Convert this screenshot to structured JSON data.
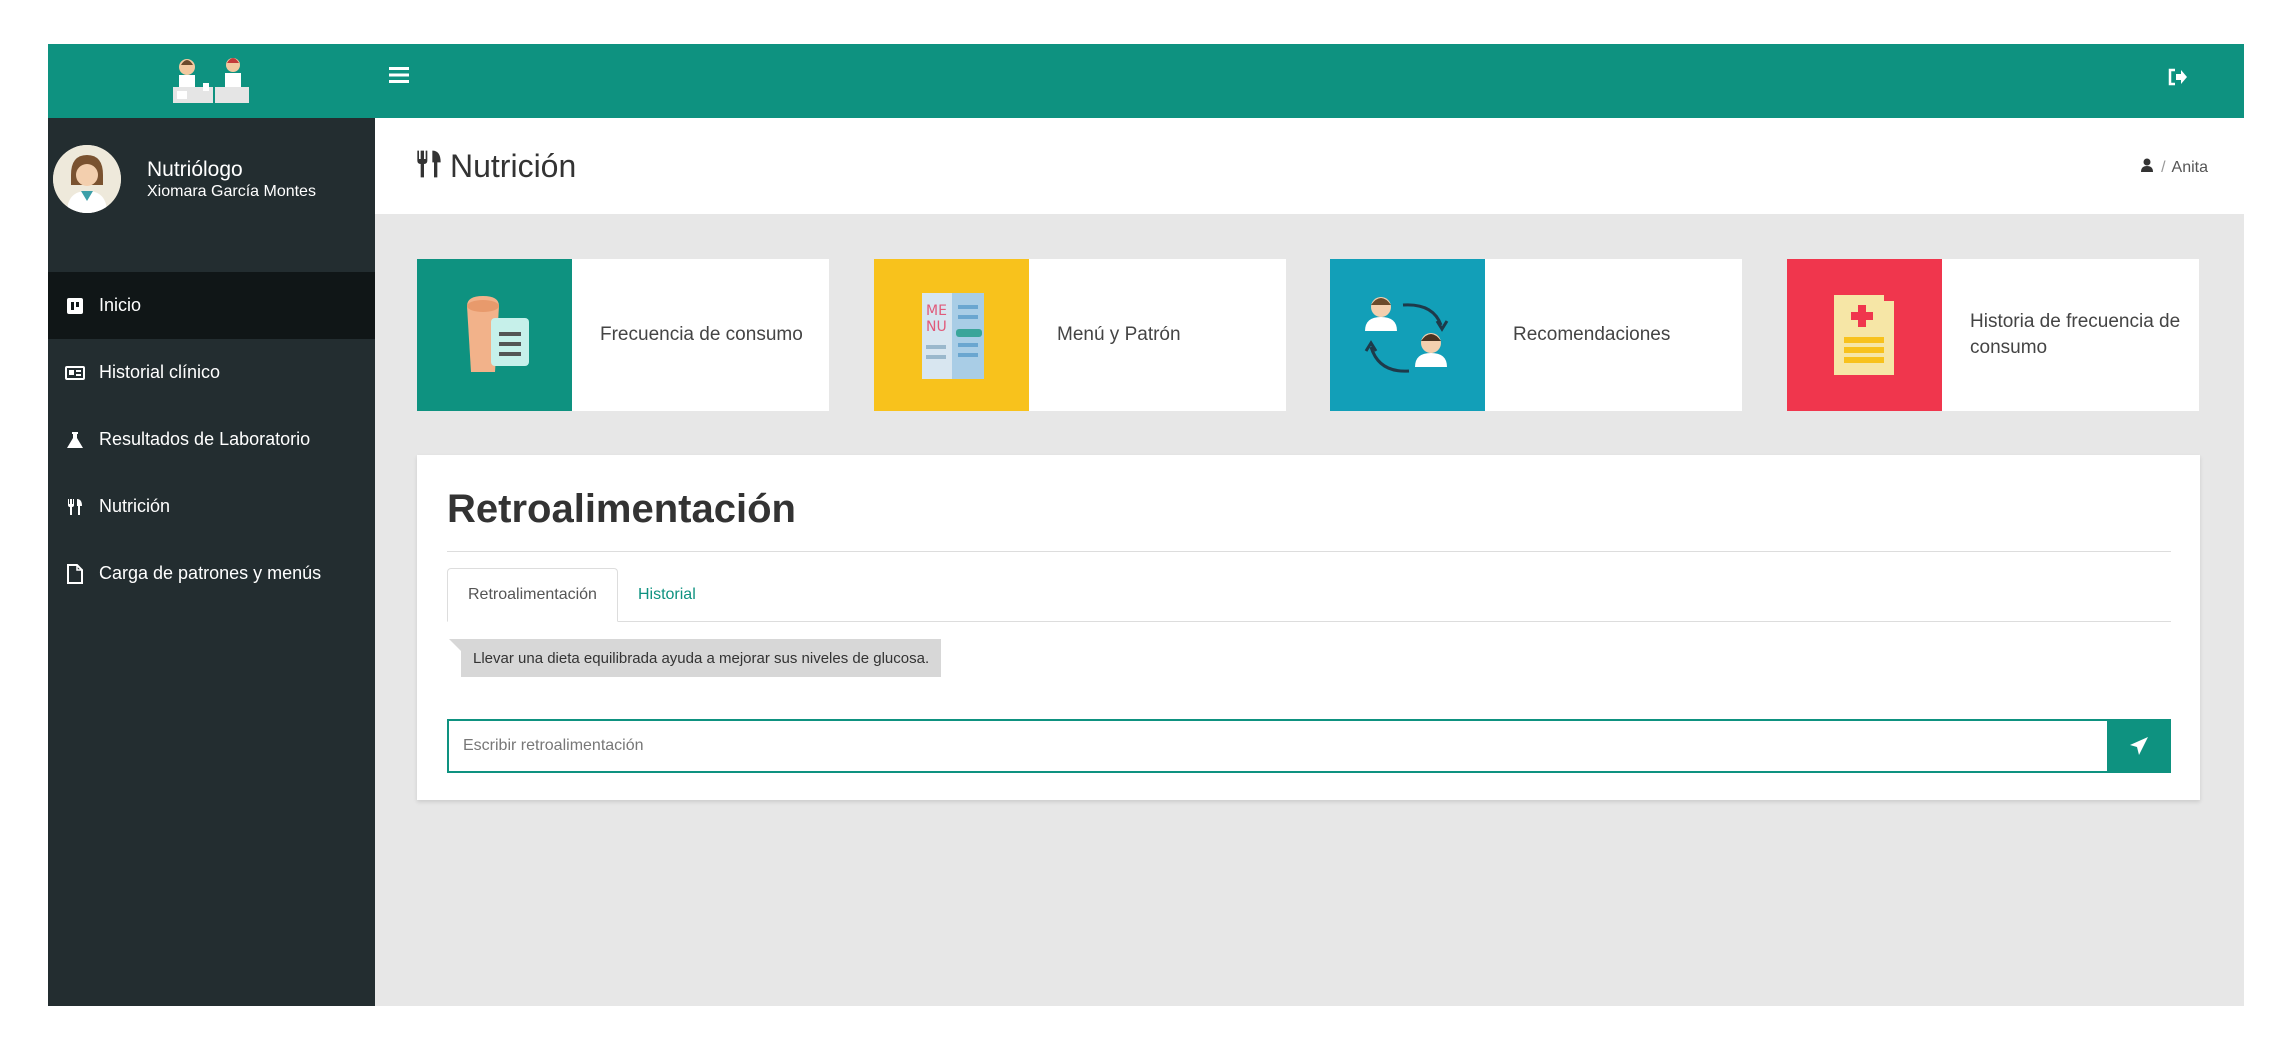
{
  "user": {
    "role": "Nutriólogo",
    "name": "Xiomara García Montes"
  },
  "sidebar": {
    "items": [
      {
        "label": "Inicio",
        "icon": "dashboard-icon"
      },
      {
        "label": "Historial clínico",
        "icon": "id-card-icon"
      },
      {
        "label": "Resultados de Laboratorio",
        "icon": "flask-icon"
      },
      {
        "label": "Nutrición",
        "icon": "cutlery-icon"
      },
      {
        "label": "Carga de patrones y menús",
        "icon": "file-icon"
      }
    ]
  },
  "header": {
    "title": "Nutrición",
    "breadcrumb_sep": "/",
    "breadcrumb_user": "Anita"
  },
  "cards": [
    {
      "label": "Frecuencia de consumo",
      "color": "#0e9280",
      "icon": "food-frequency-icon"
    },
    {
      "label": "Menú y Patrón",
      "color": "#f8c21c",
      "icon": "menu-icon"
    },
    {
      "label": "Recomendaciones",
      "color": "#129fb8",
      "icon": "recommendations-icon"
    },
    {
      "label": "Historia de frecuencia de consumo",
      "color": "#f0364d",
      "icon": "history-icon"
    }
  ],
  "feedback": {
    "title": "Retroalimentación",
    "tabs": [
      "Retroalimentación",
      "Historial"
    ],
    "message": "Llevar una dieta equilibrada ayuda a mejorar sus niveles de glucosa.",
    "input_placeholder": "Escribir retroalimentación",
    "input_value": ""
  },
  "colors": {
    "primary": "#0e9280",
    "sidebar_bg": "#232d30",
    "sidebar_active": "#101617",
    "content_bg": "#e7e7e7"
  }
}
